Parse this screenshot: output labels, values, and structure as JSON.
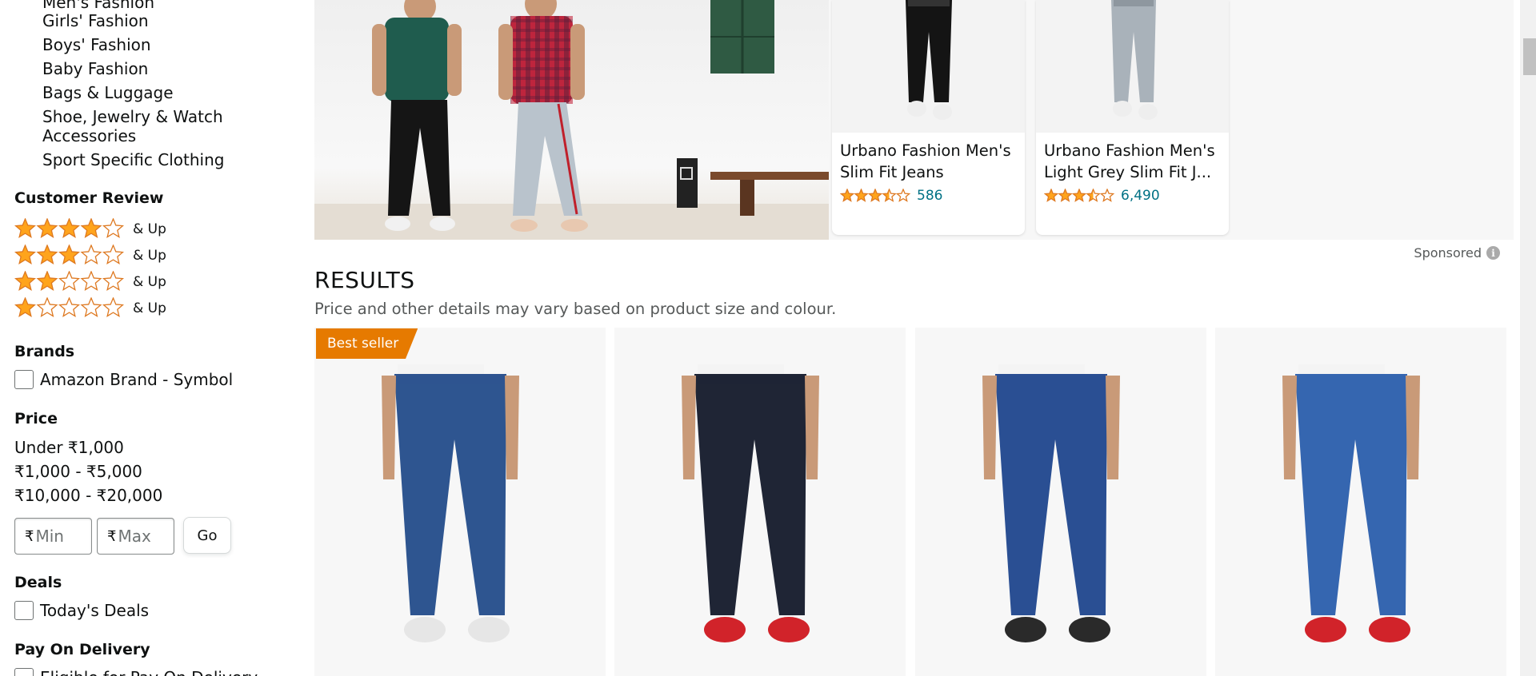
{
  "sidebar": {
    "categories": [
      "Men's Fashion",
      "Girls' Fashion",
      "Boys' Fashion",
      "Baby Fashion",
      "Bags & Luggage",
      "Shoe, Jewelry & Watch",
      "Accessories",
      "Sport Specific Clothing"
    ],
    "customer_review": {
      "title": "Customer Review",
      "rows": [
        {
          "stars": 4,
          "label": "& Up"
        },
        {
          "stars": 3,
          "label": "& Up"
        },
        {
          "stars": 2,
          "label": "& Up"
        },
        {
          "stars": 1,
          "label": "& Up"
        }
      ]
    },
    "brands": {
      "title": "Brands",
      "items": [
        "Amazon Brand - Symbol"
      ]
    },
    "price": {
      "title": "Price",
      "ranges": [
        "Under ₹1,000",
        "₹1,000 - ₹5,000",
        "₹10,000 - ₹20,000"
      ],
      "currency": "₹",
      "min_placeholder": "Min",
      "max_placeholder": "Max",
      "go_label": "Go"
    },
    "deals": {
      "title": "Deals",
      "items": [
        "Today's Deals"
      ]
    },
    "pay_on_delivery": {
      "title": "Pay On Delivery",
      "items": [
        "Eligible for Pay On Delivery"
      ]
    }
  },
  "sponsored_products": [
    {
      "title_line1": "Urbano Fashion Men's",
      "title_line2": "Slim Fit Jeans",
      "rating": 3.5,
      "count": "586"
    },
    {
      "title_line1": "Urbano Fashion Men's",
      "title_line2": "Light Grey Slim Fit J...",
      "rating": 3.5,
      "count": "6,490"
    }
  ],
  "sponsored_label": "Sponsored",
  "results": {
    "title": "RESULTS",
    "subtitle": "Price and other details may vary based on product size and colour.",
    "products": [
      {
        "badge": "Best seller",
        "jeans_color": "#2e5590",
        "shoe": "white"
      },
      {
        "badge": "",
        "jeans_color": "#1f2535",
        "shoe": "red"
      },
      {
        "badge": "",
        "jeans_color": "#2a4f93",
        "shoe": "black"
      },
      {
        "badge": "",
        "jeans_color": "#3566b0",
        "shoe": "red"
      }
    ]
  },
  "colors": {
    "star": "#ffa41c",
    "star_stroke": "#de7921",
    "link": "#007185",
    "badge": "#e67a00"
  }
}
